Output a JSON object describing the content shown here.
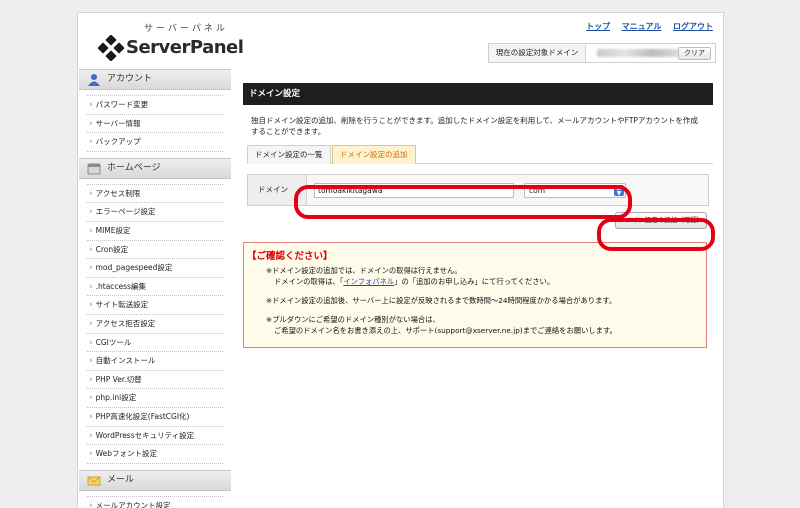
{
  "header": {
    "logo_kana": "サーバーパネル",
    "logo_text": "ServerPanel",
    "links": [
      "トップ",
      "マニュアル",
      "ログアウト"
    ],
    "current_domain_label": "現在の設定対象ドメイン",
    "clear_button": "クリア"
  },
  "sidebar": {
    "sections": [
      {
        "title": "アカウント",
        "icon": "user-icon",
        "items": [
          "パスワード変更",
          "サーバー情報",
          "バックアップ"
        ]
      },
      {
        "title": "ホームページ",
        "icon": "homepage-icon",
        "items": [
          "アクセス制限",
          "エラーページ設定",
          "MIME設定",
          "Cron設定",
          "mod_pagespeed設定",
          ".htaccess編集",
          "サイト転送設定",
          "アクセス拒否設定",
          "CGIツール",
          "自動インストール",
          "PHP Ver.切替",
          "php.ini設定",
          "PHP高速化設定(FastCGI化)",
          "WordPressセキュリティ設定",
          "Webフォント設定"
        ]
      },
      {
        "title": "メール",
        "icon": "mail-icon",
        "items": [
          "メールアカウント設定"
        ]
      }
    ]
  },
  "main": {
    "title": "ドメイン設定",
    "description": "独自ドメイン設定の追加、削除を行うことができます。追加したドメイン設定を利用して、メールアカウントやFTPアカウントを作成することができます。",
    "tabs": [
      "ドメイン設定の一覧",
      "ドメイン設定の追加"
    ],
    "form": {
      "label": "ドメイン",
      "domain_value": "tomoakikitagawa",
      "tld_value": "com"
    },
    "confirm_button": "ドメイン設定の追加（確認）",
    "notice": {
      "heading": "【ご確認ください】",
      "p1_l1": "※ドメイン設定の追加では、ドメインの取得は行えません。",
      "p1_l2_pre": "ドメインの取得は、「",
      "p1_l2_link": "インフォパネル",
      "p1_l2_post": "」の「追加のお申し込み」にて行ってください。",
      "p2": "※ドメイン設定の追加後、サーバー上に設定が反映されるまで数時間〜24時間程度かかる場合があります。",
      "p3_l1": "※プルダウンにご希望のドメイン種別がない場合は、",
      "p3_l2": "ご希望のドメイン名をお書き添えの上、サポート(support@xserver.ne.jp)までご連絡をお願いします。"
    }
  },
  "colors": {
    "highlight": "#e10014",
    "title_bar": "#1e1e1e",
    "link": "#1f4fa0",
    "notice_heading": "#d40000",
    "active_tab_text": "#d06a00"
  }
}
